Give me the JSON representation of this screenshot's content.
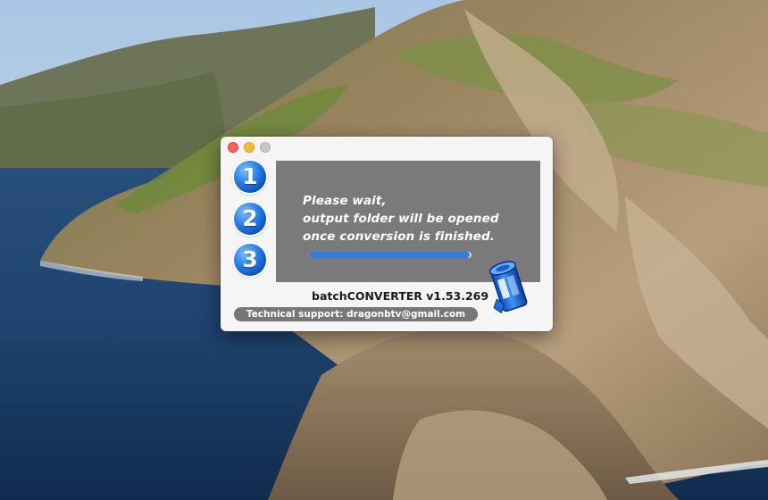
{
  "window": {
    "steps": [
      "1",
      "2",
      "3"
    ],
    "status_lines": [
      "Please wait,",
      "output folder will be opened",
      "once conversion is finished."
    ],
    "progress": 0.99,
    "app_version": "batchCONVERTER v1.53.269",
    "support_text": "Technical support: dragonbtv@gmail.com"
  },
  "icons": {
    "close": "close-button-icon",
    "minimize": "minimize-button-icon",
    "zoom": "zoom-button-icon",
    "app": "film-canister-icon"
  },
  "colors": {
    "accent": "#2e7de0",
    "panel": "#7a7a7a",
    "close": "#fe5f57",
    "minimize": "#febc2e",
    "zoom": "#c8c8c8"
  }
}
